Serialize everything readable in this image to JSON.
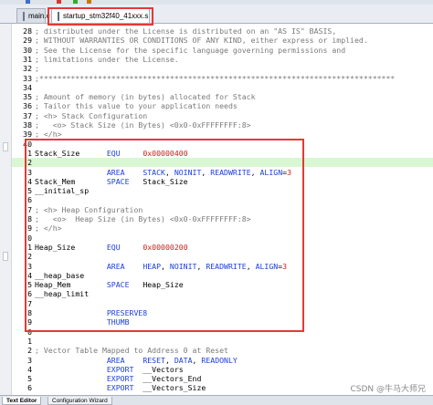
{
  "editor_tabs": [
    {
      "label": "main.c",
      "active": false
    },
    {
      "label": "startup_stm32f40_41xxx.s",
      "active": true
    }
  ],
  "bottom_tabs": [
    "Text Editor",
    "Configuration Wizard"
  ],
  "watermark": "CSDN @牛马大师兄",
  "lines": [
    {
      "num": "28",
      "text": "; distributed under the License is distributed on an \"AS IS\" BASIS,"
    },
    {
      "num": "29",
      "text": "; WITHOUT WARRANTIES OR CONDITIONS OF ANY KIND, either express or implied."
    },
    {
      "num": "30",
      "text": "; See the License for the specific language governing permissions and"
    },
    {
      "num": "31",
      "text": "; limitations under the License."
    },
    {
      "num": "32",
      "text": ";"
    },
    {
      "num": "33",
      "text": ";*******************************************************************************"
    },
    {
      "num": "34",
      "text": ""
    },
    {
      "num": "35",
      "text": "; Amount of memory (in bytes) allocated for Stack"
    },
    {
      "num": "36",
      "text": "; Tailor this value to your application needs"
    },
    {
      "num": "37",
      "text": "; <h> Stack Configuration"
    },
    {
      "num": "38",
      "text": ";   <o> Stack Size (in Bytes) <0x0-0xFFFFFFFF:8>"
    },
    {
      "num": "39",
      "text": "; </h>"
    },
    {
      "num": "40",
      "text": ""
    },
    {
      "num": "41",
      "text": "Stack_Size      EQU     0x00000400"
    },
    {
      "num": "42",
      "text": ""
    },
    {
      "num": "43",
      "text": "                AREA    STACK, NOINIT, READWRITE, ALIGN=3"
    },
    {
      "num": "44",
      "text": "Stack_Mem       SPACE   Stack_Size"
    },
    {
      "num": "45",
      "text": "__initial_sp"
    },
    {
      "num": "46",
      "text": ""
    },
    {
      "num": "47",
      "text": "; <h> Heap Configuration"
    },
    {
      "num": "48",
      "text": ";   <o>  Heap Size (in Bytes) <0x0-0xFFFFFFFF:8>"
    },
    {
      "num": "49",
      "text": "; </h>"
    },
    {
      "num": "50",
      "text": ""
    },
    {
      "num": "51",
      "text": "Heap_Size       EQU     0x00000200"
    },
    {
      "num": "52",
      "text": ""
    },
    {
      "num": "53",
      "text": "                AREA    HEAP, NOINIT, READWRITE, ALIGN=3"
    },
    {
      "num": "54",
      "text": "__heap_base"
    },
    {
      "num": "55",
      "text": "Heap_Mem        SPACE   Heap_Size"
    },
    {
      "num": "56",
      "text": "__heap_limit"
    },
    {
      "num": "57",
      "text": ""
    },
    {
      "num": "58",
      "text": "                PRESERVE8"
    },
    {
      "num": "59",
      "text": "                THUMB"
    },
    {
      "num": "60",
      "text": ""
    },
    {
      "num": "61",
      "text": ""
    },
    {
      "num": "62",
      "text": "; Vector Table Mapped to Address 0 at Reset"
    },
    {
      "num": "63",
      "text": "                AREA    RESET, DATA, READONLY"
    },
    {
      "num": "64",
      "text": "                EXPORT  __Vectors"
    },
    {
      "num": "65",
      "text": "                EXPORT  __Vectors_End"
    },
    {
      "num": "66",
      "text": "                EXPORT  __Vectors_Size"
    }
  ],
  "display_line_numbers": [
    "28",
    "29",
    "30",
    "31",
    "32",
    "33",
    "34",
    "35",
    "36",
    "37",
    "38",
    "39",
    "40",
    "1",
    "2",
    "3",
    "4",
    "5",
    "6",
    "7",
    "8",
    "9",
    "0",
    "1",
    "2",
    "3",
    "4",
    "5",
    "6",
    "7",
    "8",
    "9",
    "0",
    "1",
    "2",
    "3",
    "4",
    "5",
    "6"
  ],
  "highlighted_line": "42",
  "colors": {
    "keyword": "#1b3fd6",
    "number": "#cc1f1f",
    "comment": "#7a7a7a",
    "highlight_box": "#e53935"
  }
}
